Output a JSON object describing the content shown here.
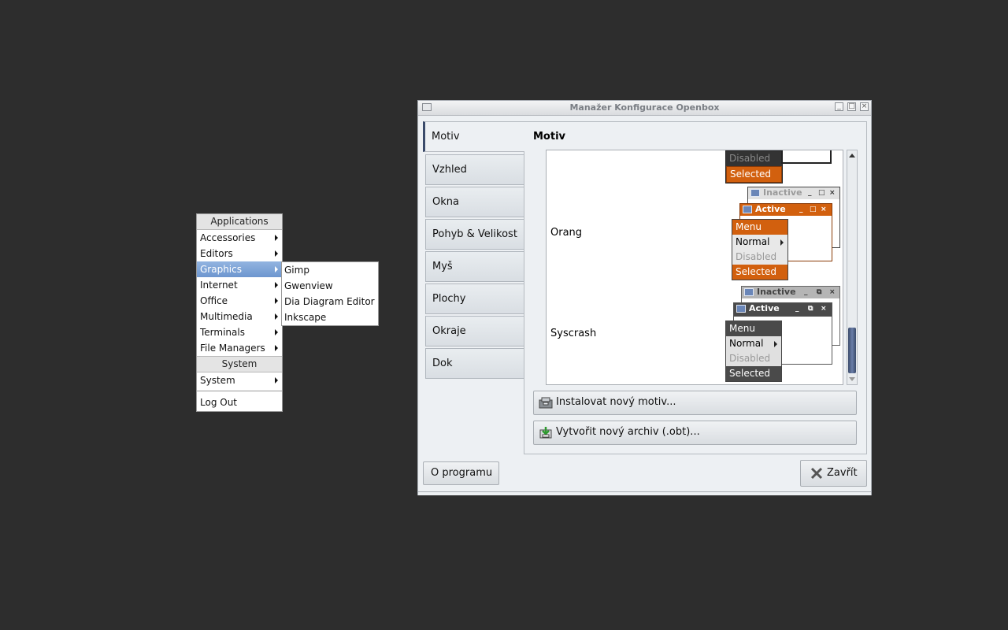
{
  "root_menu": {
    "title": "Applications",
    "items": [
      {
        "label": "Accessories"
      },
      {
        "label": "Editors"
      },
      {
        "label": "Graphics"
      },
      {
        "label": "Internet"
      },
      {
        "label": "Office"
      },
      {
        "label": "Multimedia"
      },
      {
        "label": "Terminals"
      },
      {
        "label": "File Managers"
      }
    ],
    "system_title": "System",
    "system_item": "System",
    "logout": "Log Out"
  },
  "graphics_menu": {
    "items": [
      "Gimp",
      "Gwenview",
      "Dia Diagram Editor",
      "Inkscape"
    ]
  },
  "window": {
    "title": "Manažer Konfigurace Openbox",
    "tabs": [
      "Motiv",
      "Vzhled",
      "Okna",
      "Pohyb & Velikost",
      "Myš",
      "Plochy",
      "Okraje",
      "Dok"
    ],
    "section_title": "Motiv",
    "themes": [
      {
        "name": "Orang"
      },
      {
        "name": "Syscrash"
      }
    ],
    "preview_labels": {
      "inactive": "Inactive",
      "active": "Active",
      "menu": "Menu",
      "normal": "Normal",
      "disabled": "Disabled",
      "selected": "Selected"
    },
    "install_button": "Instalovat nový motiv...",
    "archive_button": "Vytvořit nový archiv (.obt)...",
    "about_button": "O programu",
    "close_button": "Zavřít"
  },
  "colors": {
    "desktop": "#2d2d2d",
    "menu_highlight": "#7aa0d6",
    "orang_accent": "#d2600e",
    "syscrash_dark": "#4a4a4a"
  }
}
